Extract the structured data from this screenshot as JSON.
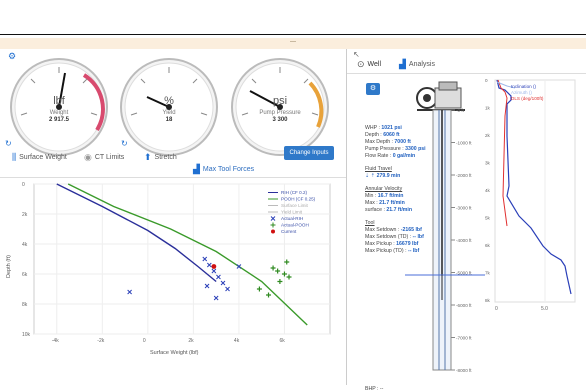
{
  "gauges": [
    {
      "unit": "lbf",
      "label": "Weight",
      "value": "2 917.5"
    },
    {
      "unit": "%",
      "label": "Yield",
      "value": "18"
    },
    {
      "unit": "psi",
      "label": "Pump Pressure",
      "value": "3 300"
    }
  ],
  "tabs": [
    {
      "label": "Surface Weight",
      "icon": "bars-icon"
    },
    {
      "label": "CT Limits",
      "icon": "eye-icon"
    },
    {
      "label": "Stretch",
      "icon": "arrow-up-icon"
    }
  ],
  "change_inputs_label": "Change Inputs",
  "max_tool_forces_label": "Max Tool Forces",
  "right_tabs": [
    {
      "label": "Well",
      "icon": "well-icon"
    },
    {
      "label": "Analysis",
      "icon": "chart-icon"
    }
  ],
  "well_info": {
    "whp_label": "WHP :",
    "whp_value": "1021 psi",
    "depth_label": "Depth :",
    "depth_value": "6060 ft",
    "maxdepth_label": "Max Depth :",
    "maxdepth_value": "7000 ft",
    "pump_label": "Pump Pressure :",
    "pump_value": "3300 psi",
    "flow_label": "Flow Rate :",
    "flow_value": "0 gal/min",
    "fluid_title": "Fluid Travel",
    "fluid_value": "279.9 min",
    "annular_title": "Annular Velocity",
    "min_label": "Min :",
    "min_value": "16.7 ft/min",
    "max_label": "Max :",
    "max_value": "21.7 ft/min",
    "surface_label": "surface :",
    "surface_value": "21.7 ft/min",
    "tool_title": "Tool",
    "ms_label": "Max Setdown :",
    "ms_value": "-2165 lbf",
    "mstd_label": "Max Setdown (TD) :",
    "mstd_value": "-- lbf",
    "mp_label": "Max Pickup :",
    "mp_value": "16679 lbf",
    "mptd_label": "Max Pickup (TD) :",
    "mptd_value": "-- lbf",
    "bhp_label": "BHP : --"
  },
  "well_depth_ticks": [
    "-0 ft",
    "-1000 ft",
    "-2000 ft",
    "-3000 ft",
    "-4000 ft",
    "-5000 ft",
    "-6000 ft",
    "-7000 ft",
    "-8000 ft"
  ],
  "right_legend": [
    "Inclination ()",
    "Azimuth ()",
    "DLS (deg/100ft)"
  ],
  "right_chart": {
    "y_ticks": [
      "0",
      "1k",
      "2k",
      "3k",
      "4k",
      "5k",
      "6k",
      "7k",
      "8k"
    ],
    "x_ticks": [
      "0",
      "5.0"
    ],
    "colors": {
      "inclination": "#2a3fb8",
      "azimuth": "#9fb7e8",
      "dls": "#e03030"
    }
  },
  "chart_data": {
    "type": "scatter",
    "xlabel": "Surface Weight (lbf)",
    "ylabel": "Depth (ft)",
    "x_ticks": [
      "-4k",
      "-2k",
      "0",
      "2k",
      "4k",
      "6k"
    ],
    "y_ticks": [
      "0",
      "2k",
      "4k",
      "6k",
      "8k",
      "10k"
    ],
    "xlim": [
      -5000,
      8000
    ],
    "ylim": [
      0,
      10000
    ],
    "legend": [
      "RIH (CF 0.2)",
      "POOH (CF 0.25)",
      "Surface Limit",
      "Yield Limit",
      "Actual-RIH",
      "Actual-POOH",
      "Current"
    ],
    "series": [
      {
        "name": "RIH (CF 0.2)",
        "color": "#2a2f9a",
        "line": true,
        "x": [
          -4000,
          -2000,
          0,
          1200,
          2200,
          3000
        ],
        "y": [
          0,
          1500,
          3100,
          4300,
          5500,
          6500
        ]
      },
      {
        "name": "POOH (CF 0.25)",
        "color": "#3a9a2a",
        "line": true,
        "x": [
          -3500,
          -1500,
          1000,
          3000,
          5000,
          7000
        ],
        "y": [
          0,
          1500,
          3000,
          4500,
          6500,
          9400
        ]
      },
      {
        "name": "Actual-RIH",
        "color": "#2a3fb8",
        "marker": "x",
        "x": [
          -800,
          2500,
          2700,
          2900,
          3100,
          3300,
          3500,
          4000,
          2600,
          3000
        ],
        "y": [
          7200,
          5000,
          5400,
          5800,
          6200,
          6600,
          7000,
          5500,
          6800,
          7600
        ]
      },
      {
        "name": "Actual-POOH",
        "color": "#2f8a20",
        "marker": "+",
        "x": [
          5500,
          5700,
          6000,
          6200,
          5800,
          6100,
          4900,
          5300
        ],
        "y": [
          5600,
          5800,
          6000,
          6200,
          6500,
          5200,
          7000,
          7400
        ]
      },
      {
        "name": "Current",
        "color": "#d01010",
        "marker": "dot",
        "x": [
          2900
        ],
        "y": [
          5500
        ]
      }
    ]
  }
}
